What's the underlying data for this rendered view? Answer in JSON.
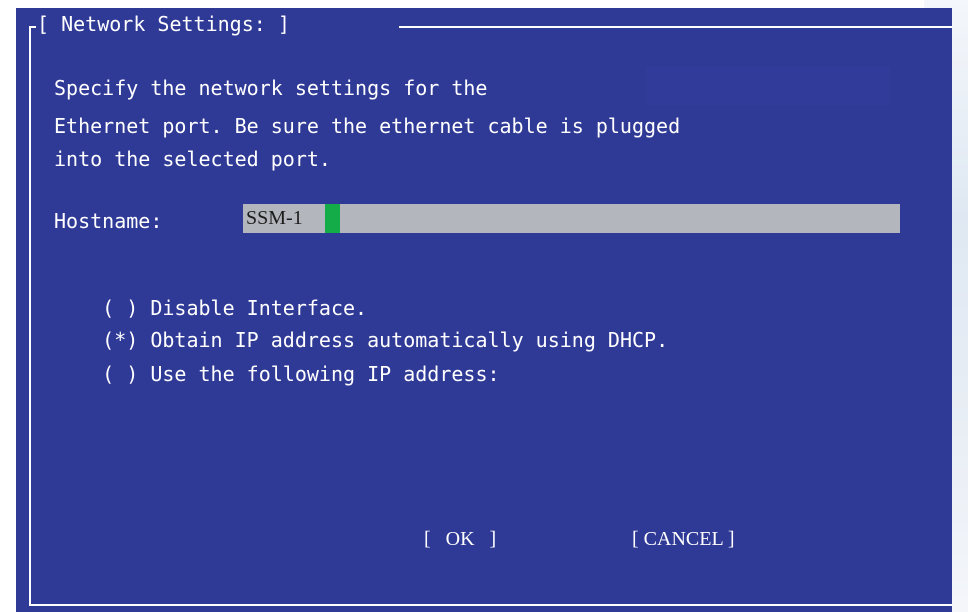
{
  "dialog": {
    "title": "[ Network Settings: ]",
    "description_lines": [
      "Specify the network settings for the",
      "Ethernet port. Be sure the ethernet cable is plugged",
      "into the selected port."
    ]
  },
  "hostname": {
    "label": "Hostname:",
    "value": "SSM-1"
  },
  "options": [
    {
      "marker": "( )",
      "label": "Disable Interface.",
      "selected": false
    },
    {
      "marker": "(*)",
      "label": "Obtain IP address automatically using DHCP.",
      "selected": true
    },
    {
      "marker": "( )",
      "label": "Use the following IP address:",
      "selected": false
    }
  ],
  "buttons": {
    "ok": "[   OK   ]",
    "cancel": "[ CANCEL ]"
  },
  "colors": {
    "screen_background": "#2f3996",
    "field_background": "#b3b6bd",
    "cursor": "#13ac48",
    "text": "#ffffff"
  }
}
